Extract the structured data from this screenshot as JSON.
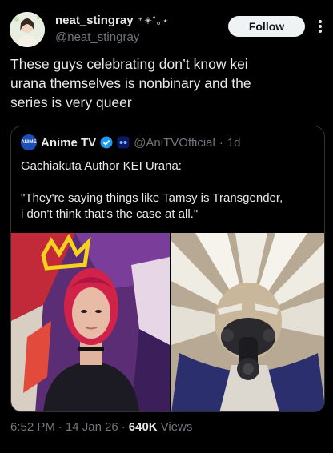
{
  "author": {
    "display_name": "neat_stingray",
    "name_decoration": "⁺✳︎˚｡⋆",
    "handle": "@neat_stingray",
    "avatar_icon": "profile-avatar"
  },
  "actions": {
    "follow_label": "Follow",
    "more_icon": "more-vertical-icon"
  },
  "tweet": {
    "text_lines": [
      "These guys celebrating don’t know kei",
      "urana themselves is nonbinary and the",
      "series is very queer"
    ]
  },
  "quote": {
    "avatar_label": "ANIME",
    "display_name": "Anime TV",
    "verified_icon": "verified-badge-icon",
    "affiliate_icon": "affiliate-badge-icon",
    "handle": "@AniTVOfficial",
    "separator": "·",
    "time": "1d",
    "body_lines": [
      "Gachiakuta Author KEI Urana:",
      "",
      "\"They're saying things like Tamsy is Transgender,",
      "i don't think that's the case at all.\""
    ],
    "image_left_icon": "author-photo",
    "image_right_icon": "character-artwork"
  },
  "meta": {
    "time": "6:52 PM",
    "sep1": "·",
    "date": "14 Jan 26",
    "sep2": "·",
    "views_count": "640K",
    "views_label": "Views"
  },
  "colors": {
    "background": "#000000",
    "text": "#e7e9ea",
    "muted": "#71767b",
    "border": "#2f3336",
    "verified": "#1d9bf0"
  }
}
